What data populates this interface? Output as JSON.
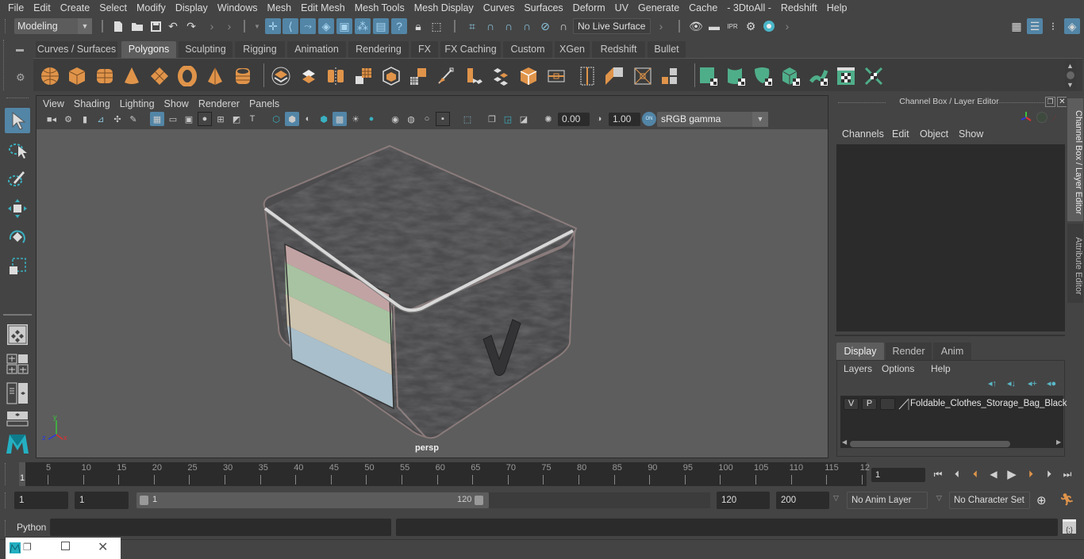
{
  "menubar": {
    "items": [
      "File",
      "Edit",
      "Create",
      "Select",
      "Modify",
      "Display",
      "Windows",
      "Mesh",
      "Edit Mesh",
      "Mesh Tools",
      "Mesh Display",
      "Curves",
      "Surfaces",
      "Deform",
      "UV",
      "Generate",
      "Cache",
      "- 3DtoAll -",
      "Redshift",
      "Help"
    ]
  },
  "statusline": {
    "workspace": "Modeling",
    "live_surface": "No Live Surface",
    "icons": [
      "new-scene-icon",
      "open-scene-icon",
      "save-scene-icon",
      "undo-icon",
      "redo-icon",
      "select-by-hierarchy-icon",
      "select-by-component-icon",
      "select-by-object-icon",
      "snap-grid-icon",
      "snap-curve-icon",
      "snap-point-icon",
      "snap-view-plane-icon",
      "make-live-icon",
      "render-view-icon",
      "render-frame-icon",
      "ipr-render-icon",
      "render-settings-icon",
      "hypershade-icon"
    ]
  },
  "shelf": {
    "tabs": [
      "Curves / Surfaces",
      "Polygons",
      "Sculpting",
      "Rigging",
      "Animation",
      "Rendering",
      "FX",
      "FX Caching",
      "Custom",
      "XGen",
      "Redshift",
      "Bullet"
    ],
    "active_tab": "Polygons",
    "icons": [
      "poly-sphere-icon",
      "poly-cube-icon",
      "poly-cylinder-icon",
      "poly-cone-icon",
      "poly-plane-icon",
      "poly-torus-icon",
      "poly-pyramid-icon",
      "poly-pipe-icon",
      "combine-icon",
      "separate-icon",
      "mirror-icon",
      "smooth-icon",
      "remesh-icon",
      "extrude-icon",
      "bevel-icon",
      "bridge-icon",
      "multi-cut-icon",
      "target-weld-icon",
      "insert-edge-loop-icon",
      "append-to-polygon-icon",
      "planar-mapping-icon",
      "automatic-mapping-icon",
      "cylindrical-mapping-icon",
      "uv-editor-icon",
      "spherical-mapping-icon",
      "uv-layout-icon",
      "unfold-icon",
      "cut-uv-icon",
      "sew-uv-icon"
    ]
  },
  "viewport": {
    "menu": [
      "View",
      "Shading",
      "Lighting",
      "Show",
      "Renderer",
      "Panels"
    ],
    "exposure": "0.00",
    "gamma": "1.00",
    "color_management": "ON",
    "color_space": "sRGB gamma",
    "camera_label": "persp",
    "axis": {
      "x": "x",
      "y": "y",
      "z": "z"
    }
  },
  "channel_box": {
    "title": "Channel Box / Layer Editor",
    "menu": [
      "Channels",
      "Edit",
      "Object",
      "Show"
    ],
    "layer_tabs": [
      "Display",
      "Render",
      "Anim"
    ],
    "active_layer_tab": "Display",
    "layer_menu": [
      "Layers",
      "Options",
      "Help"
    ],
    "layers": [
      {
        "visible": "V",
        "playback": "P",
        "name": "Foldable_Clothes_Storage_Bag_Black"
      }
    ]
  },
  "side_tabs": [
    "Channel Box / Layer Editor",
    "Attribute Editor"
  ],
  "timeline": {
    "tick_labels": [
      "5",
      "10",
      "15",
      "20",
      "25",
      "30",
      "35",
      "40",
      "45",
      "50",
      "55",
      "60",
      "65",
      "70",
      "75",
      "80",
      "85",
      "90",
      "95",
      "100",
      "105",
      "110",
      "115",
      "12"
    ],
    "current_frame_marker": "1",
    "current_frame": "1",
    "start": 1,
    "end": 120
  },
  "range": {
    "start_time": "1",
    "playback_start": "1",
    "range_start_label": "1",
    "range_end_label": "120",
    "playback_end": "120",
    "end_time": "200",
    "anim_layer": "No Anim Layer",
    "character_set": "No Character Set"
  },
  "command_line": {
    "language": "Python",
    "input": "",
    "output": ""
  },
  "colors": {
    "selected_blue": "#5285a6",
    "shelf_orange": "#e0944a",
    "shelf_green": "#4fae8a",
    "viewport_bg": "#5d5d5d",
    "panel_bg": "#444444",
    "field_bg": "#2b2b2b"
  }
}
